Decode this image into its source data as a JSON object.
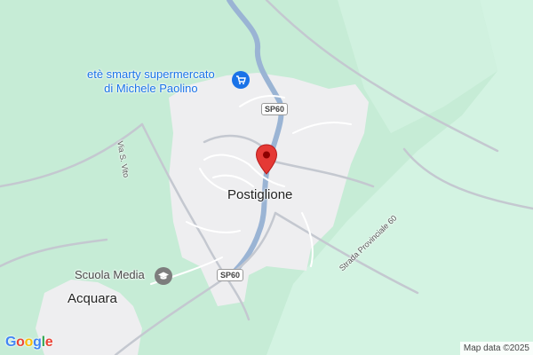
{
  "map": {
    "pois": {
      "supermarket": {
        "line1": "etè smarty supermercato",
        "line2": "di Michele Paolino",
        "icon": "shopping-cart-icon",
        "color": "#1a73e8"
      },
      "school": {
        "name": "Scuola Media",
        "icon": "school-icon"
      }
    },
    "places": {
      "main_town": "Postiglione",
      "secondary_town": "Acquara"
    },
    "roads": {
      "via_svito": "Via S. Vito",
      "strada_provinciale": "Strada Provinciale 60",
      "shield_top": "SP60",
      "shield_bottom": "SP60"
    },
    "marker": {
      "icon": "location-pin-icon",
      "color": "#e53935"
    },
    "attribution": "Map data ©2025",
    "logo": "Google"
  }
}
